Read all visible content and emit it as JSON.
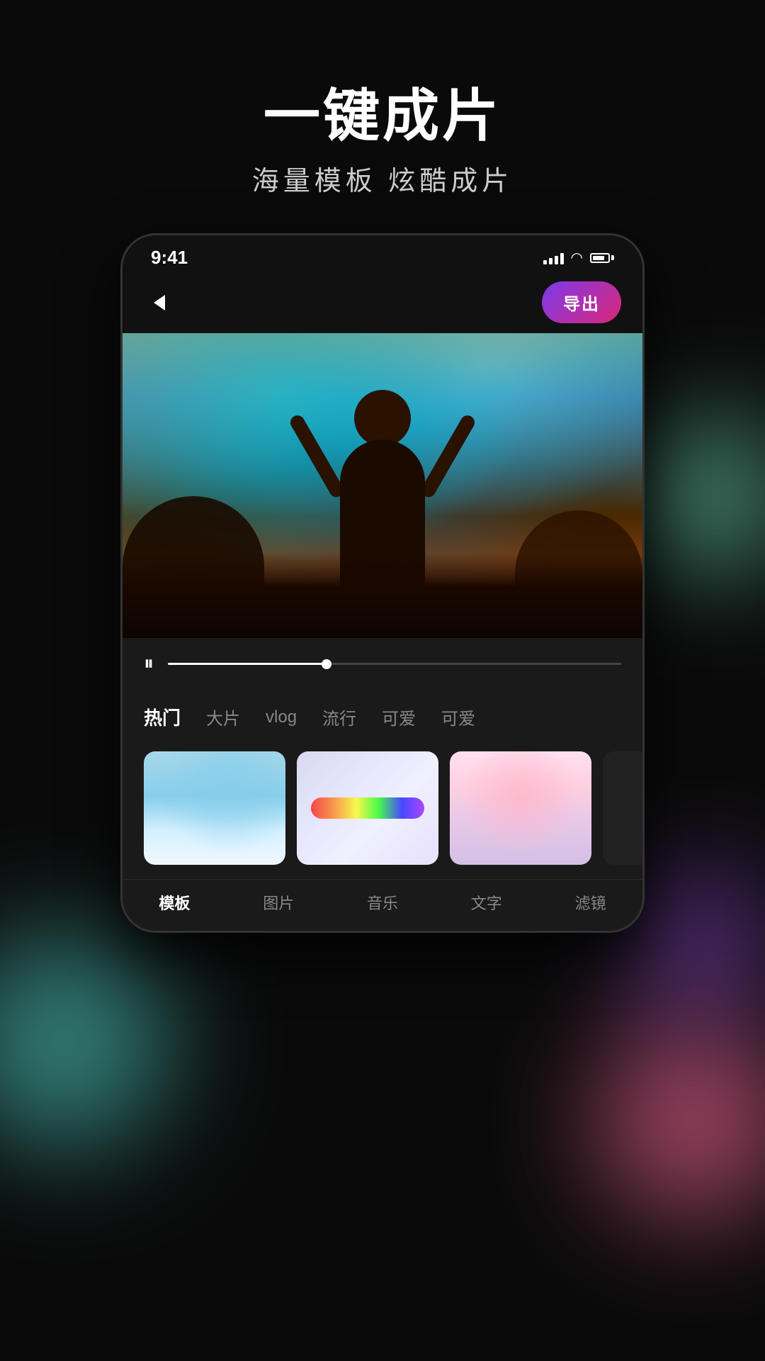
{
  "background": {
    "color": "#0a0a0a"
  },
  "hero": {
    "main_title": "一键成片",
    "sub_title": "海量模板  炫酷成片"
  },
  "phone": {
    "status_bar": {
      "time": "9:41",
      "signal_label": "signal",
      "wifi_label": "wifi",
      "battery_label": "battery"
    },
    "nav": {
      "back_label": "back",
      "export_button": "导出"
    },
    "video": {
      "description": "concert crowd scene"
    },
    "playback": {
      "pause_icon": "⏸",
      "progress_percent": 35
    },
    "categories": [
      {
        "label": "热门",
        "active": true
      },
      {
        "label": "大片",
        "active": false
      },
      {
        "label": "vlog",
        "active": false
      },
      {
        "label": "流行",
        "active": false
      },
      {
        "label": "可爱",
        "active": false
      },
      {
        "label": "可爱",
        "active": false
      }
    ],
    "templates": [
      {
        "id": 1,
        "description": "sky blue template"
      },
      {
        "id": 2,
        "description": "rainbow prism template"
      },
      {
        "id": 3,
        "description": "pink sunset template"
      },
      {
        "id": 4,
        "description": "dark template"
      }
    ],
    "bottom_nav": [
      {
        "label": "模板",
        "active": true
      },
      {
        "label": "图片",
        "active": false
      },
      {
        "label": "音乐",
        "active": false
      },
      {
        "label": "文字",
        "active": false
      },
      {
        "label": "滤镜",
        "active": false
      }
    ]
  }
}
